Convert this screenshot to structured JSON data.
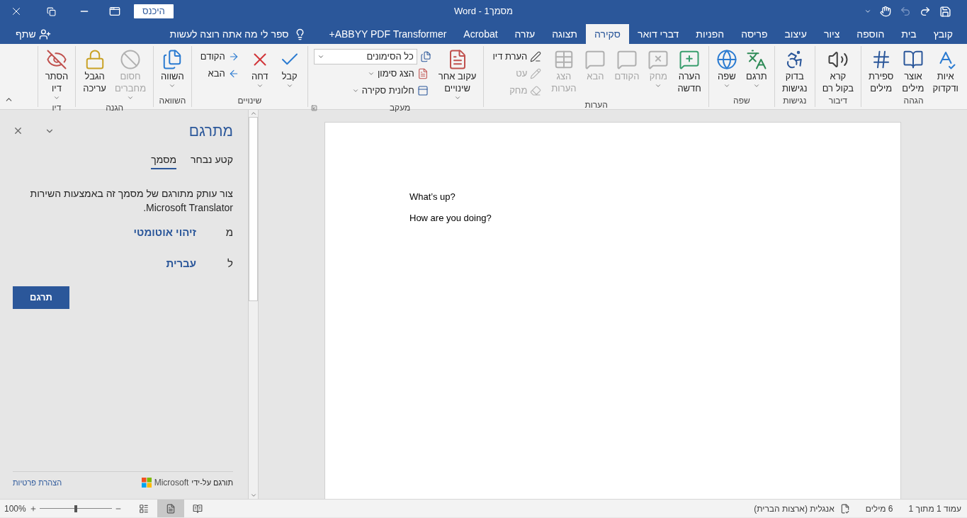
{
  "title_bar": {
    "title": "מסמך1 - Word",
    "sign_in": "היכנס",
    "undo_disabled": true
  },
  "tabs": [
    {
      "label": "קובץ",
      "selected": false
    },
    {
      "label": "בית",
      "selected": false
    },
    {
      "label": "הוספה",
      "selected": false
    },
    {
      "label": "ציור",
      "selected": false
    },
    {
      "label": "עיצוב",
      "selected": false
    },
    {
      "label": "פריסה",
      "selected": false
    },
    {
      "label": "הפניות",
      "selected": false
    },
    {
      "label": "דברי דואר",
      "selected": false
    },
    {
      "label": "סקירה",
      "selected": true
    },
    {
      "label": "תצוגה",
      "selected": false
    },
    {
      "label": "עזרה",
      "selected": false
    },
    {
      "label": "Acrobat",
      "selected": false
    },
    {
      "label": "ABBYY PDF Transformer+",
      "selected": false
    }
  ],
  "tell_me": "ספר לי מה אתה רוצה לעשות",
  "share": "שתף",
  "ribbon_groups": [
    {
      "name": "הגהה",
      "launcher": false,
      "items": [
        {
          "kind": "large",
          "lines": [
            "איות",
            "ודקדוק"
          ],
          "disabled": false,
          "menu": false
        },
        {
          "kind": "large",
          "lines": [
            "אוצר",
            "מילים"
          ],
          "disabled": false,
          "menu": false
        },
        {
          "kind": "large",
          "lines": [
            "ספירת",
            "מילים"
          ],
          "disabled": false,
          "menu": false
        }
      ]
    },
    {
      "name": "דיבור",
      "launcher": false,
      "items": [
        {
          "kind": "large",
          "lines": [
            "קרא",
            "בקול רם"
          ],
          "disabled": false,
          "menu": false
        }
      ]
    },
    {
      "name": "נגישות",
      "launcher": false,
      "items": [
        {
          "kind": "large",
          "lines": [
            "בדוק",
            "נגישות"
          ],
          "disabled": false,
          "menu": false
        }
      ]
    },
    {
      "name": "שפה",
      "launcher": false,
      "items": [
        {
          "kind": "large",
          "lines": [
            "תרגם"
          ],
          "disabled": false,
          "menu": true
        },
        {
          "kind": "large",
          "lines": [
            "שפה"
          ],
          "disabled": false,
          "menu": true
        }
      ]
    },
    {
      "name": "הערות",
      "launcher": false,
      "items": [
        {
          "kind": "large",
          "lines": [
            "הערה",
            "חדשה"
          ],
          "disabled": false,
          "menu": false
        },
        {
          "kind": "large",
          "lines": [
            "מחק"
          ],
          "disabled": true,
          "menu": true
        },
        {
          "kind": "large",
          "lines": [
            "הקודם"
          ],
          "disabled": true,
          "menu": false
        },
        {
          "kind": "large",
          "lines": [
            "הבא"
          ],
          "disabled": true,
          "menu": false
        },
        {
          "kind": "large",
          "lines": [
            "הצג",
            "הערות"
          ],
          "disabled": true,
          "menu": false
        },
        {
          "kind": "small",
          "lines": [
            "הערת דיו"
          ],
          "disabled": false,
          "menu": false
        },
        {
          "kind": "small",
          "lines": [
            "עט"
          ],
          "disabled": true,
          "menu": false
        },
        {
          "kind": "small",
          "lines": [
            "מחק"
          ],
          "disabled": true,
          "menu": false
        }
      ]
    },
    {
      "name": "מעקב",
      "launcher": true,
      "items": [
        {
          "kind": "large",
          "lines": [
            "עקוב אחר",
            "שינויים"
          ],
          "disabled": false,
          "menu": true
        },
        {
          "kind": "select",
          "lines": [
            "כל הסימונים"
          ],
          "disabled": false,
          "menu": true
        },
        {
          "kind": "small",
          "lines": [
            "הצג סימון"
          ],
          "disabled": false,
          "menu": true
        },
        {
          "kind": "small",
          "lines": [
            "חלונית סקירה"
          ],
          "disabled": false,
          "menu": true
        }
      ]
    },
    {
      "name": "שינויים",
      "launcher": false,
      "items": [
        {
          "kind": "large",
          "lines": [
            "קבל"
          ],
          "disabled": false,
          "menu": true
        },
        {
          "kind": "large",
          "lines": [
            "דחה"
          ],
          "disabled": false,
          "menu": true
        },
        {
          "kind": "small",
          "lines": [
            "הקודם"
          ],
          "disabled": false,
          "menu": false
        },
        {
          "kind": "small",
          "lines": [
            "הבא"
          ],
          "disabled": false,
          "menu": false
        }
      ]
    },
    {
      "name": "השוואה",
      "launcher": false,
      "items": [
        {
          "kind": "large",
          "lines": [
            "השווה"
          ],
          "disabled": false,
          "menu": true
        }
      ]
    },
    {
      "name": "הגנה",
      "launcher": false,
      "items": [
        {
          "kind": "large",
          "lines": [
            "חסום",
            "מחברים"
          ],
          "disabled": true,
          "menu": true
        },
        {
          "kind": "large",
          "lines": [
            "הגבל",
            "עריכה"
          ],
          "disabled": false,
          "menu": false
        }
      ]
    },
    {
      "name": "דיו",
      "launcher": false,
      "items": [
        {
          "kind": "large",
          "lines": [
            "הסתר",
            "דיו"
          ],
          "disabled": false,
          "menu": true
        }
      ]
    }
  ],
  "translator": {
    "title": "מתרגם",
    "tabs": [
      {
        "label": "קטע נבחר",
        "selected": false
      },
      {
        "label": "מסמך",
        "selected": true
      }
    ],
    "description": "צור עותק מתורגם של מסמך זה באמצעות השירות Microsoft Translator.",
    "from_label": "מ",
    "from_value": "זיהוי אוטומטי",
    "to_label": "ל",
    "to_value": "עברית",
    "button": "תרגם",
    "credit": "תורגם על-ידי",
    "brand": "Microsoft",
    "privacy": "הצהרת פרטיות"
  },
  "document": {
    "paragraphs": [
      "What’s up?",
      "How are you doing?"
    ]
  },
  "status_bar": {
    "page": "עמוד 1 מתוך 1",
    "words": "6 מילים",
    "language": "אנגלית (ארצות הברית)",
    "zoom": "100%",
    "zoom_slider": {
      "level": 0.5
    },
    "views": [
      {
        "selected": false
      },
      {
        "selected": true
      },
      {
        "selected": false
      }
    ]
  }
}
